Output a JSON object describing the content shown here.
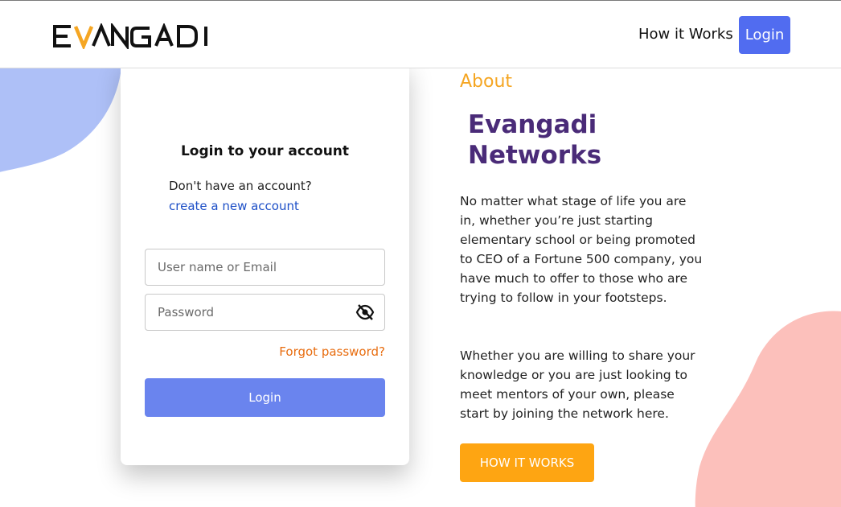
{
  "header": {
    "logo_text": "EVANGADI",
    "nav_how_it_works": "How it Works",
    "nav_login": "Login"
  },
  "login_card": {
    "title": "Login to your account",
    "no_account_text": "Don't have an account?",
    "create_account_link": "create a new account",
    "username_placeholder": "User name or Email",
    "password_placeholder": "Password",
    "password_toggle_icon": "eye-off-icon",
    "forgot_password": "Forgot password?",
    "login_button": "Login"
  },
  "about": {
    "label": "About",
    "title_line1": "Evangadi",
    "title_line2": "Networks",
    "paragraph1": "No matter what stage of life you are in, whether you’re just starting elementary school or being promoted to CEO of a Fortune 500 company, you have much to offer to those who are trying to follow in your footsteps.",
    "paragraph2": "Whether you are willing to share your knowledge or you are just looking to meet mentors of your own, please start by joining the network here.",
    "cta_button": "HOW IT WORKS"
  },
  "colors": {
    "brand_orange": "#f5a623",
    "nav_login_bg": "#516cf0",
    "login_button_bg": "#6a84ee",
    "link_blue": "#1d4fc7",
    "forgot_orange": "#e86d10",
    "title_purple": "#4a2b78",
    "cta_bg": "#fea512",
    "blob_left": "#aec0f7",
    "blob_right": "#fcc0bb"
  }
}
